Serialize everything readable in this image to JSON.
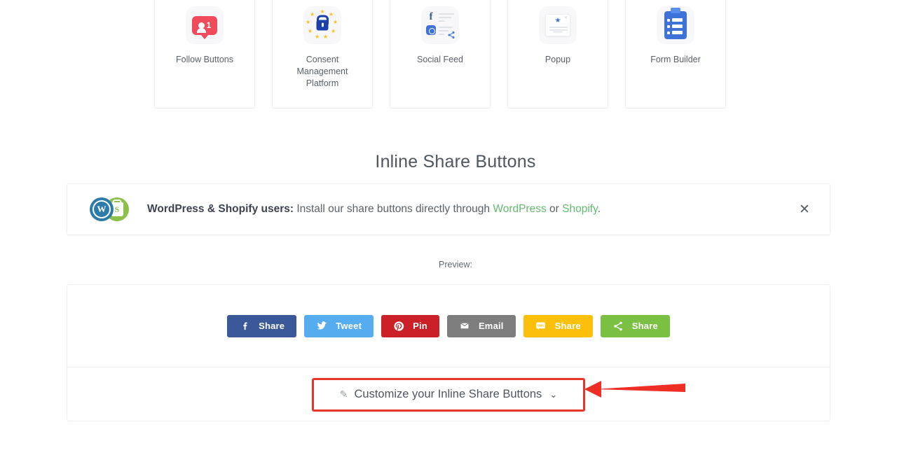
{
  "products": [
    {
      "label": "Follow Buttons",
      "icon": "follow-buttons-icon",
      "badge": "1"
    },
    {
      "label": "Consent Management Platform",
      "icon": "lock-stars-icon"
    },
    {
      "label": "Social Feed",
      "icon": "social-feed-icon"
    },
    {
      "label": "Popup",
      "icon": "popup-icon"
    },
    {
      "label": "Form Builder",
      "icon": "clipboard-form-icon"
    }
  ],
  "section": {
    "title": "Inline Share Buttons"
  },
  "notice": {
    "lead": "WordPress & Shopify users:",
    "body_before": " Install our share buttons directly through ",
    "link1": "WordPress",
    "between": " or ",
    "link2": "Shopify",
    "tail": ".",
    "close_icon": "close-icon",
    "link_color": "#66b96f",
    "wordpress_logo": "wordpress-logo",
    "shopify_logo": "shopify-logo"
  },
  "preview": {
    "label": "Preview:",
    "buttons": [
      {
        "label": "Share",
        "network": "facebook",
        "icon": "facebook-icon",
        "color": "#3b5998"
      },
      {
        "label": "Tweet",
        "network": "twitter",
        "icon": "twitter-icon",
        "color": "#55acee"
      },
      {
        "label": "Pin",
        "network": "pinterest",
        "icon": "pinterest-icon",
        "color": "#cb2027"
      },
      {
        "label": "Email",
        "network": "email",
        "icon": "envelope-icon",
        "color": "#7d7d7d"
      },
      {
        "label": "Share",
        "network": "sms",
        "icon": "sms-icon",
        "color": "#fcc00a"
      },
      {
        "label": "Share",
        "network": "sharethis",
        "icon": "share-network-icon",
        "color": "#7ac143"
      }
    ]
  },
  "customize": {
    "label": "Customize your Inline Share Buttons",
    "pencil_icon": "pencil-icon",
    "chevron_icon": "chevron-down-icon",
    "highlight_color": "#e8342a"
  },
  "annotation": {
    "arrow_icon": "arrow-left-annotation",
    "color": "#ee2d24"
  }
}
